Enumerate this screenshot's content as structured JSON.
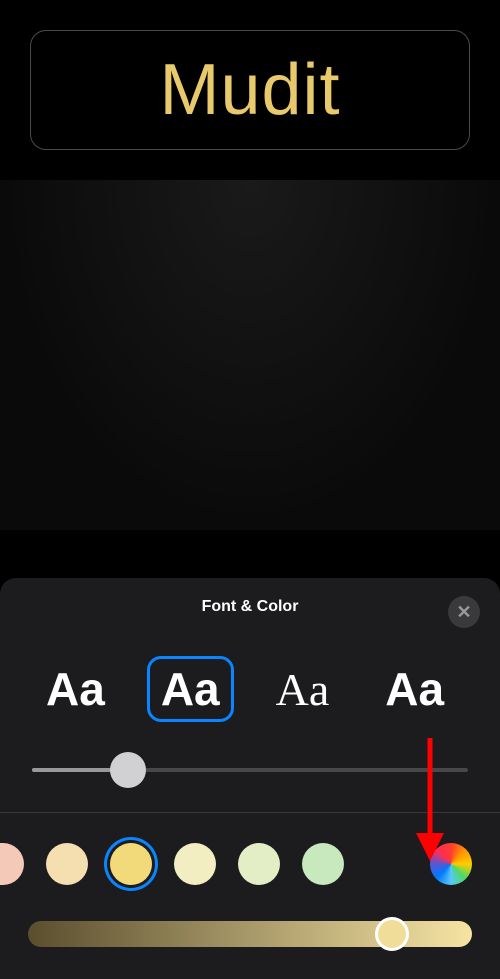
{
  "preview": {
    "name": "Mudit",
    "color": "#e8c96b"
  },
  "sheet": {
    "title": "Font & Color",
    "close_label": "✕"
  },
  "fonts": {
    "options": [
      {
        "label": "Aa",
        "style": "sans1",
        "selected": false
      },
      {
        "label": "Aa",
        "style": "sans2",
        "selected": true
      },
      {
        "label": "Aa",
        "style": "serif",
        "selected": false
      },
      {
        "label": "Aa",
        "style": "sans1",
        "selected": false
      }
    ],
    "size_value": 22
  },
  "colors": {
    "swatches": [
      {
        "hex": "#f4c9b8",
        "partial": true,
        "selected": false
      },
      {
        "hex": "#f5deb0",
        "partial": false,
        "selected": false
      },
      {
        "hex": "#f2da7a",
        "partial": false,
        "selected": true
      },
      {
        "hex": "#f2eec2",
        "partial": false,
        "selected": false
      },
      {
        "hex": "#e3edc6",
        "partial": false,
        "selected": false
      },
      {
        "hex": "#c8e8bd",
        "partial": false,
        "selected": false
      }
    ],
    "brightness_value": 82
  }
}
